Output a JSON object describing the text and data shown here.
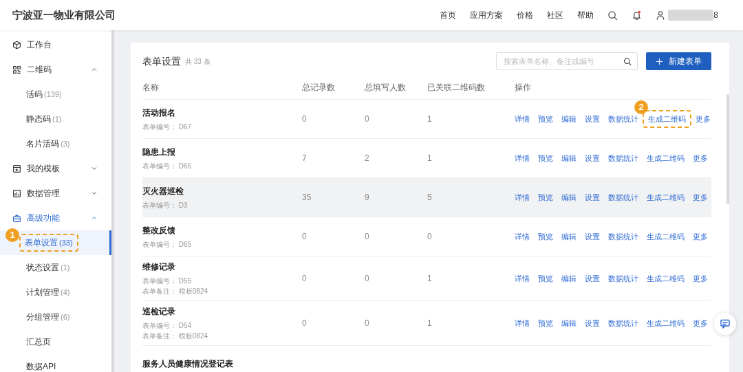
{
  "header": {
    "company": "宁波亚一物业有限公司",
    "nav": [
      "首页",
      "应用方案",
      "价格",
      "社区",
      "帮助"
    ],
    "notification_dot": true,
    "user_suffix": "8"
  },
  "sidebar": {
    "items": [
      {
        "label": "工作台",
        "active": false
      },
      {
        "label": "二维码",
        "active": false,
        "expanded": true,
        "children": [
          {
            "label": "活码",
            "count": "(139)",
            "selected": false
          },
          {
            "label": "静态码",
            "count": "(1)",
            "selected": false
          },
          {
            "label": "名片活码",
            "count": "(3)",
            "selected": false
          }
        ]
      },
      {
        "label": "我的模板",
        "active": false,
        "expanded": false
      },
      {
        "label": "数据管理",
        "active": false,
        "expanded": false
      },
      {
        "label": "高级功能",
        "active": true,
        "expanded": true,
        "children": [
          {
            "label": "表单设置",
            "count": "(33)",
            "selected": true,
            "callout": "1"
          },
          {
            "label": "状态设置",
            "count": "(1)",
            "selected": false
          },
          {
            "label": "计划管理",
            "count": "(4)",
            "selected": false
          },
          {
            "label": "分组管理",
            "count": "(6)",
            "selected": false
          },
          {
            "label": "汇总页",
            "selected": false
          },
          {
            "label": "数据API",
            "selected": false
          }
        ]
      }
    ]
  },
  "main": {
    "title": "表单设置",
    "total": "共 33 条",
    "search": {
      "placeholder": "搜索表单名称、备注或编号"
    },
    "new_button": "新建表单",
    "table": {
      "columns": [
        "名称",
        "总记录数",
        "总填写人数",
        "已关联二维码数",
        "操作"
      ],
      "rows": [
        {
          "name": "活动报名",
          "code_label": "表单编号：",
          "code": "D67",
          "records": "0",
          "fillers": "0",
          "qrcodes": "1",
          "hovered": false,
          "actions": [
            {
              "label": "详情"
            },
            {
              "label": "预览"
            },
            {
              "label": "编辑"
            },
            {
              "label": "设置"
            },
            {
              "label": "数据统计"
            },
            {
              "label": "生成二维码",
              "callout": "2"
            },
            {
              "label": "更多"
            }
          ]
        },
        {
          "name": "隐患上报",
          "code_label": "表单编号：",
          "code": "D66",
          "records": "7",
          "fillers": "2",
          "qrcodes": "1",
          "hovered": false,
          "actions": [
            {
              "label": "详情"
            },
            {
              "label": "预览"
            },
            {
              "label": "编辑"
            },
            {
              "label": "设置"
            },
            {
              "label": "数据统计"
            },
            {
              "label": "生成二维码"
            },
            {
              "label": "更多"
            }
          ]
        },
        {
          "name": "灭火器巡检",
          "code_label": "表单编号：",
          "code": "D3",
          "records": "35",
          "fillers": "9",
          "qrcodes": "5",
          "hovered": true,
          "actions": [
            {
              "label": "详情"
            },
            {
              "label": "预览"
            },
            {
              "label": "编辑"
            },
            {
              "label": "设置"
            },
            {
              "label": "数据统计"
            },
            {
              "label": "生成二维码"
            },
            {
              "label": "更多"
            }
          ]
        },
        {
          "name": "整改反馈",
          "code_label": "表单编号：",
          "code": "D65",
          "records": "0",
          "fillers": "0",
          "qrcodes": "0",
          "hovered": false,
          "actions": [
            {
              "label": "详情"
            },
            {
              "label": "预览"
            },
            {
              "label": "编辑"
            },
            {
              "label": "设置"
            },
            {
              "label": "数据统计"
            },
            {
              "label": "生成二维码"
            },
            {
              "label": "更多"
            }
          ]
        },
        {
          "name": "维修记录",
          "code_label": "表单编号：",
          "code": "D55",
          "note_label": "表单备注：",
          "note": "模板0824",
          "records": "0",
          "fillers": "0",
          "qrcodes": "1",
          "hovered": false,
          "actions": [
            {
              "label": "详情"
            },
            {
              "label": "预览"
            },
            {
              "label": "编辑"
            },
            {
              "label": "设置"
            },
            {
              "label": "数据统计"
            },
            {
              "label": "生成二维码"
            },
            {
              "label": "更多"
            }
          ]
        },
        {
          "name": "巡检记录",
          "code_label": "表单编号：",
          "code": "D54",
          "note_label": "表单备注：",
          "note": "模板0824",
          "records": "0",
          "fillers": "0",
          "qrcodes": "1",
          "hovered": false,
          "actions": [
            {
              "label": "详情"
            },
            {
              "label": "预览"
            },
            {
              "label": "编辑"
            },
            {
              "label": "设置"
            },
            {
              "label": "数据统计"
            },
            {
              "label": "生成二维码"
            },
            {
              "label": "更多"
            }
          ]
        },
        {
          "name": "服务人员健康情况登记表",
          "hovered": false
        }
      ]
    }
  }
}
